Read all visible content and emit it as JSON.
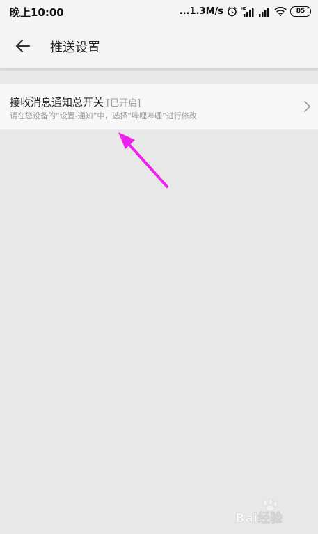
{
  "status_bar": {
    "time": "晚上10:00",
    "network_speed": "...1.3M/s",
    "hd_label": "HD",
    "battery": "85",
    "icons": [
      "alarm-icon",
      "signal-icon",
      "wifi-icon",
      "battery-icon"
    ]
  },
  "header": {
    "title": "推送设置",
    "back_icon": "arrow-left-icon"
  },
  "settings": {
    "items": [
      {
        "title": "接收消息通知总开关",
        "status": "[已开启]",
        "description": "请在您设备的“设置-通知”中，选择“哔哩哔哩”进行修改",
        "icon": "chevron-right-icon"
      }
    ]
  },
  "annotation": {
    "arrow_color": "#ee22ee"
  },
  "watermark": {
    "text": "Bai经验"
  },
  "colors": {
    "background": "#e8e8e8",
    "item_bg": "#f7f7f7",
    "secondary_text": "#9a9a9a"
  }
}
